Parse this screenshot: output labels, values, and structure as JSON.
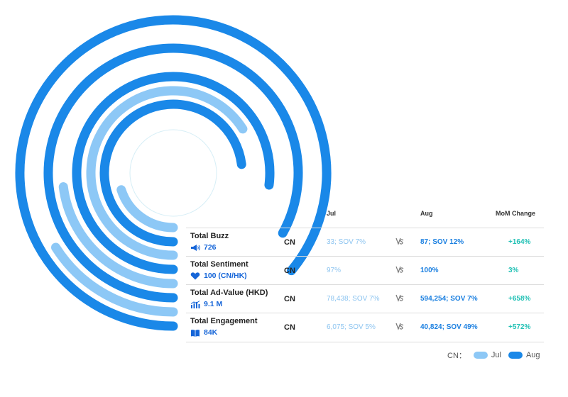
{
  "chart_data": {
    "type": "radial-bar",
    "region": "CN",
    "columns": {
      "jul": "Jul",
      "aug": "Aug",
      "mom": "MoM Change"
    },
    "series": [
      {
        "name": "Jul",
        "color": "#8dc8f6"
      },
      {
        "name": "Aug",
        "color": "#1a88e8"
      }
    ],
    "rows": [
      {
        "metric": "Total Buzz",
        "summary": "726",
        "icon": "megaphone-icon",
        "region": "CN",
        "jul": "33; SOV 7%",
        "aug": "87; SOV 12%",
        "mom": "+164%",
        "jul_value": 33,
        "aug_value": 87
      },
      {
        "metric": "Total Sentiment",
        "summary": "100 (CN/HK)",
        "icon": "heart-icon",
        "region": "CN",
        "jul": "97%",
        "aug": "100%",
        "mom": "3%",
        "jul_value": 97,
        "aug_value": 100
      },
      {
        "metric": "Total Ad-Value (HKD)",
        "summary": "9.1 M",
        "icon": "bar-chart-icon",
        "region": "CN",
        "jul": "78,438; SOV 7%",
        "aug": "594,254; SOV 7%",
        "mom": "+658%",
        "jul_value": 78438,
        "aug_value": 594254
      },
      {
        "metric": "Total Engagement",
        "summary": "84K",
        "icon": "book-icon",
        "region": "CN",
        "jul": "6,075; SOV 5%",
        "aug": "40,824; SOV 49%",
        "mom": "+572%",
        "jul_value": 6075,
        "aug_value": 40824
      }
    ],
    "arc_fraction": {
      "aug": [
        0.86,
        0.83,
        0.77,
        0.73
      ],
      "jul": [
        0.16,
        0.23,
        0.66,
        0.2
      ]
    },
    "legend": {
      "prefix": "CN：",
      "jul": "Jul",
      "aug": "Aug",
      "position": "bottom-right"
    }
  }
}
